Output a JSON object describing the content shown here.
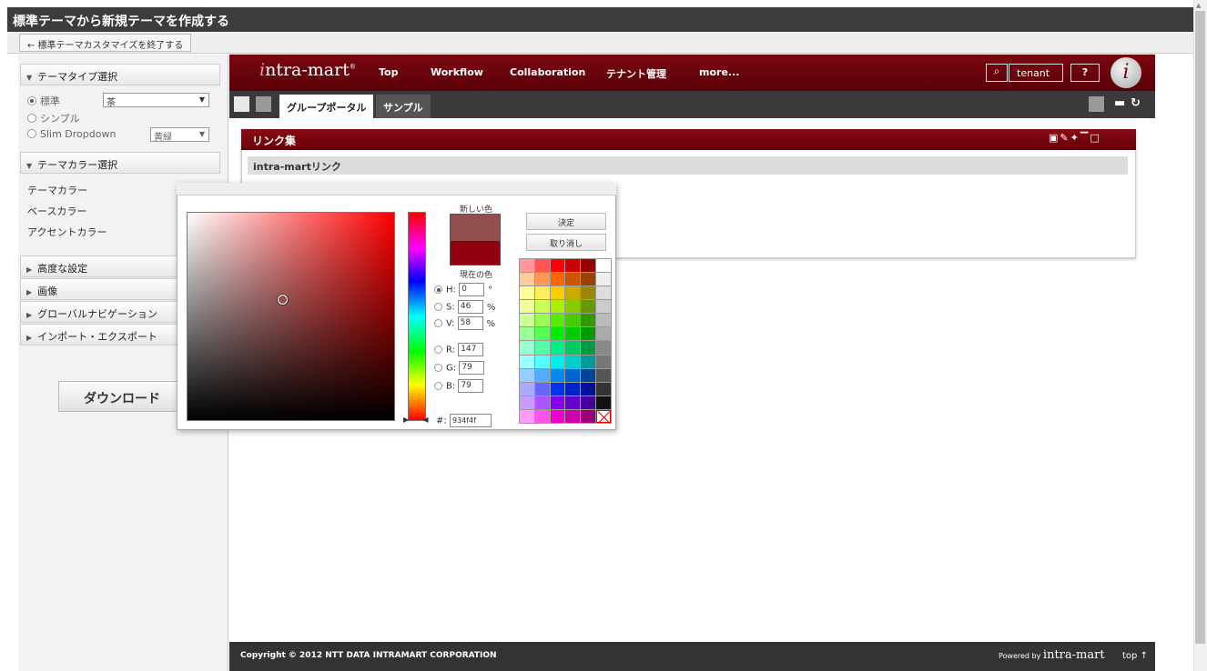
{
  "header": {
    "title": "標準テーマから新規テーマを作成する",
    "exit_label": "← 標準テーマカスタマイズを終了する"
  },
  "sidebar": {
    "theme_type_label": "テーマタイプ選択",
    "type_standard": "標準",
    "standard_select": "茶",
    "type_simple": "シンプル",
    "type_slim": "Slim Dropdown",
    "slim_select": "黄緑",
    "theme_color_label": "テーマカラー選択",
    "theme_color": "テーマカラー",
    "base_color": "ベースカラー",
    "accent_color": "アクセントカラー",
    "advanced": "高度な設定",
    "image": "画像",
    "global_nav": "グローバルナビゲーション",
    "import_export": "インポート・エクスポート",
    "download": "ダウンロード"
  },
  "topnav": {
    "logo_i": "i",
    "logo_rest": "ntra-mart",
    "items": [
      "Top",
      "Workflow",
      "Collaboration",
      "テナント管理",
      "more..."
    ],
    "tenant": "tenant",
    "help": "?",
    "user_icon_letter": "i"
  },
  "tabs": [
    "グループポータル",
    "サンプル"
  ],
  "portlet": {
    "title": "リンク集",
    "link_row": "intra-martリンク"
  },
  "picker": {
    "new_color_label": "新しい色",
    "current_color_label": "現在の色",
    "ok": "決定",
    "cancel": "取り消し",
    "h_label": "H:",
    "h_value": "0",
    "h_unit": "°",
    "s_label": "S:",
    "s_value": "46",
    "s_unit": "%",
    "v_label": "V:",
    "v_value": "58",
    "v_unit": "%",
    "r_label": "R:",
    "r_value": "147",
    "g_label": "G:",
    "g_value": "79",
    "b_label": "B:",
    "b_value": "79",
    "hex_label": "#:",
    "hex_value": "934f4f",
    "new_color": "#934f4f",
    "current_color": "#930010",
    "palette": [
      "#ff9999",
      "#ff5555",
      "#ff0000",
      "#cc0000",
      "#990000",
      "#ffffff",
      "#ffcc99",
      "#ff9955",
      "#ff6600",
      "#cc5500",
      "#994400",
      "#eeeeee",
      "#ffff99",
      "#ffee55",
      "#ffcc00",
      "#ccaa00",
      "#998800",
      "#dddddd",
      "#eeff99",
      "#ccff55",
      "#aaee00",
      "#88cc00",
      "#669900",
      "#cccccc",
      "#ccff99",
      "#99ff55",
      "#55ee00",
      "#44cc00",
      "#339900",
      "#bbbbbb",
      "#99ff99",
      "#55ff55",
      "#00ee00",
      "#00cc00",
      "#009900",
      "#aaaaaa",
      "#99ffcc",
      "#55ffaa",
      "#00ee88",
      "#00cc66",
      "#009944",
      "#888888",
      "#99ffff",
      "#55ffff",
      "#00eeee",
      "#00cccc",
      "#009999",
      "#777777",
      "#99ccff",
      "#55aaff",
      "#0088ee",
      "#0066cc",
      "#004499",
      "#555555",
      "#aaaaff",
      "#6666ff",
      "#0033ee",
      "#0022cc",
      "#001199",
      "#333333",
      "#cc99ff",
      "#aa55ff",
      "#8800ee",
      "#6600cc",
      "#440099",
      "#111111",
      "#ff99ff",
      "#ff55ee",
      "#ee00cc",
      "#cc00aa",
      "#990077",
      "none"
    ]
  },
  "footer": {
    "copyright": "Copyright © 2012 NTT DATA INTRAMART CORPORATION",
    "powered_by": "Powered by ",
    "powered_logo": "intra-mart",
    "top_link": "top ↑"
  },
  "colors": {
    "brand": "#7a0710",
    "titlebar": "#3c3c3c"
  }
}
